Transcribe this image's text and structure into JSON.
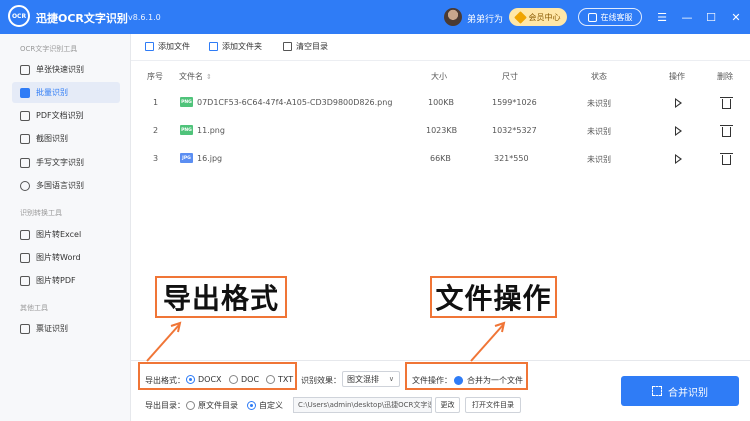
{
  "app": {
    "logo_text": "OCR",
    "title": "迅捷OCR文字识别",
    "version": "v8.6.1.0",
    "username": "弟弟行为",
    "vip_label": "会员中心",
    "service_label": "在线客服",
    "menu_glyph": "☰",
    "minimize_glyph": "—",
    "maximize_glyph": "☐",
    "close_glyph": "✕"
  },
  "sidebar": {
    "section1": "OCR文字识别工具",
    "section2": "识别转换工具",
    "section3": "其他工具",
    "items": [
      "单张快速识别",
      "批量识别",
      "PDF文档识别",
      "截图识别",
      "手写文字识别",
      "多国语言识别",
      "图片转Excel",
      "图片转Word",
      "图片转PDF",
      "票证识别"
    ],
    "active_index": 1
  },
  "toolbar": {
    "add_file": "添加文件",
    "add_folder": "添加文件夹",
    "clear": "清空目录"
  },
  "table": {
    "headers": {
      "index": "序号",
      "name": "文件名",
      "size": "大小",
      "dimensions": "尺寸",
      "status": "状态",
      "action": "操作",
      "delete": "删除"
    },
    "sort_glyph": "⇕",
    "rows": [
      {
        "index": "1",
        "type": "PNG",
        "name": "07D1CF53-6C64-47f4-A105-CD3D9800D826.png",
        "size": "100KB",
        "dimensions": "1599*1026",
        "status": "未识别"
      },
      {
        "index": "2",
        "type": "PNG",
        "name": "11.png",
        "size": "1023KB",
        "dimensions": "1032*5327",
        "status": "未识别"
      },
      {
        "index": "3",
        "type": "JPG",
        "name": "16.jpg",
        "size": "66KB",
        "dimensions": "321*550",
        "status": "未识别"
      }
    ]
  },
  "bottom": {
    "export_format_label": "导出格式：",
    "formats": [
      "DOCX",
      "DOC",
      "TXT"
    ],
    "selected_format": "DOCX",
    "recognize_effect_label": "识别效果：",
    "recognize_effect_value": "图文混排",
    "file_op_label": "文件操作：",
    "file_op_option": "合并为一个文件",
    "export_dir_label": "导出目录：",
    "dir_options": [
      "原文件目录",
      "自定义"
    ],
    "selected_dir": "自定义",
    "path": "C:\\Users\\admin\\desktop\\迅捷OCR文字识别",
    "change_button": "更改",
    "open_folder_button": "打开文件目录",
    "merge_button": "合并识别",
    "chevron": "∨"
  },
  "annotations": {
    "export_format": "导出格式",
    "file_operation": "文件操作"
  },
  "colors": {
    "brand": "#2f7cf6",
    "annotation": "#f07536"
  }
}
